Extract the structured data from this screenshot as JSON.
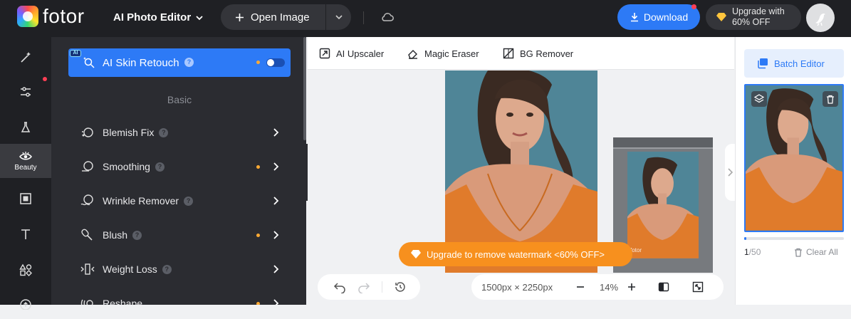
{
  "app": {
    "brand": "fotor",
    "mode_label": "AI Photo Editor"
  },
  "header": {
    "open_image_label": "Open Image",
    "download_label": "Download",
    "upgrade_line1": "Upgrade with",
    "upgrade_line2": "60% OFF"
  },
  "nav": {
    "items": [
      {
        "name": "ai-tools",
        "label": ""
      },
      {
        "name": "adjust",
        "label": ""
      },
      {
        "name": "effects",
        "label": ""
      },
      {
        "name": "beauty",
        "label": "Beauty"
      },
      {
        "name": "frames",
        "label": ""
      },
      {
        "name": "text",
        "label": ""
      },
      {
        "name": "elements",
        "label": ""
      },
      {
        "name": "more",
        "label": ""
      }
    ]
  },
  "panel": {
    "ai_badge": "AI",
    "skin_retouch_label": "AI Skin Retouch",
    "help_glyph": "?",
    "section_title": "Basic",
    "tools": [
      {
        "label": "Blemish Fix",
        "dot": false
      },
      {
        "label": "Smoothing",
        "dot": true
      },
      {
        "label": "Wrinkle Remover",
        "dot": false
      },
      {
        "label": "Blush",
        "dot": true
      },
      {
        "label": "Weight Loss",
        "dot": false
      },
      {
        "label": "Reshape",
        "dot": true
      }
    ]
  },
  "toolbar": {
    "upscaler_label": "AI Upscaler",
    "eraser_label": "Magic Eraser",
    "bg_remover_label": "BG Remover"
  },
  "canvas": {
    "watermark_cta": "Upgrade to remove watermark <60% OFF>",
    "thumb_watermark": "fotor",
    "dimensions": "1500px × 2250px",
    "zoom": "14%"
  },
  "right": {
    "batch_label": "Batch Editor",
    "progress_fraction": 0.02,
    "count_current": "1",
    "count_total": "/50",
    "clear_label": "Clear All"
  },
  "colors": {
    "accent": "#2d7af6",
    "orange": "#f7901e",
    "dark": "#1f2024",
    "panel": "#2b2c31"
  }
}
